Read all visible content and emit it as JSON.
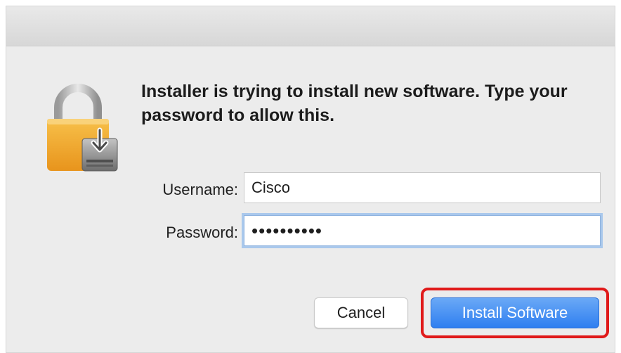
{
  "dialog": {
    "message": "Installer is trying to install new software. Type your password to allow this.",
    "icon": "lock-installer-icon"
  },
  "fields": {
    "username": {
      "label": "Username:",
      "value": "Cisco"
    },
    "password": {
      "label": "Password:",
      "value": "••••••••••"
    }
  },
  "buttons": {
    "cancel": "Cancel",
    "install": "Install Software"
  },
  "colors": {
    "accent": "#2f7ff0",
    "highlight": "#e01a1a",
    "lock_body": "#f0a92e"
  }
}
